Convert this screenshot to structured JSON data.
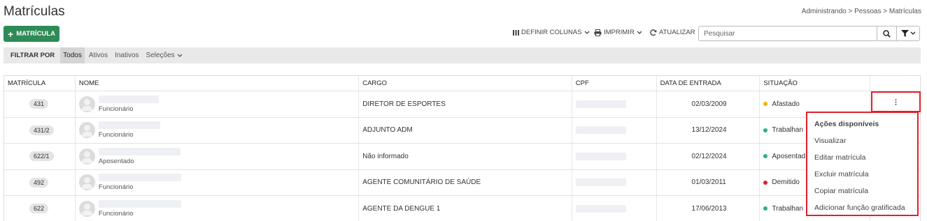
{
  "page": {
    "title": "Matrículas",
    "breadcrumb": "Administrando > Pessoas > Matrículas"
  },
  "toolbar": {
    "add_label": "MATRÍCULA",
    "define_columns": "DEFINIR COLUNAS",
    "print": "IMPRIMIR",
    "update": "ATUALIZAR",
    "search_placeholder": "Pesquisar"
  },
  "filter": {
    "label": "FILTRAR POR",
    "tabs": [
      "Todos",
      "Ativos",
      "Inativos",
      "Seleções"
    ],
    "active": "Todos"
  },
  "table": {
    "headers": [
      "MATRÍCULA",
      "NOME",
      "CARGO",
      "CPF",
      "DATA DE ENTRADA",
      "SITUAÇÃO"
    ],
    "rows": [
      {
        "matricula": "431",
        "tipo": "Funcionário",
        "cargo": "DIRETOR DE ESPORTES",
        "data": "02/03/2009",
        "situacao": "Afastado",
        "situacao_color": "#f0b400"
      },
      {
        "matricula": "431/2",
        "tipo": "Funcionário",
        "cargo": "ADJUNTO ADM",
        "data": "13/12/2024",
        "situacao": "Trabalhan",
        "situacao_color": "#2ab27b"
      },
      {
        "matricula": "622/1",
        "tipo": "Aposentado",
        "cargo": "Não informado",
        "data": "02/12/2024",
        "situacao": "Aposentad",
        "situacao_color": "#2ab27b"
      },
      {
        "matricula": "492",
        "tipo": "Funcionário",
        "cargo": "AGENTE COMUNITÁRIO DE SAÚDE",
        "data": "01/03/2011",
        "situacao": "Demitido",
        "situacao_color": "#e2202a"
      },
      {
        "matricula": "622",
        "tipo": "Funcionário",
        "cargo": "AGENTE DA DENGUE 1",
        "data": "17/06/2013",
        "situacao": "Trabalhan",
        "situacao_color": "#2ab27b"
      }
    ]
  },
  "actions_menu": {
    "title": "Ações disponíveis",
    "items": [
      "Visualizar",
      "Editar matrícula",
      "Excluir matrícula",
      "Copiar matrícula",
      "Adicionar função gratificada"
    ]
  },
  "colors": {
    "primary": "#2e8b57",
    "highlight": "#e2202a"
  },
  "icons": {
    "add": "plus-icon",
    "columns": "columns-icon",
    "print": "printer-icon",
    "update": "refresh-icon",
    "search": "search-icon",
    "filter": "funnel-icon",
    "more": "kebab-icon"
  }
}
